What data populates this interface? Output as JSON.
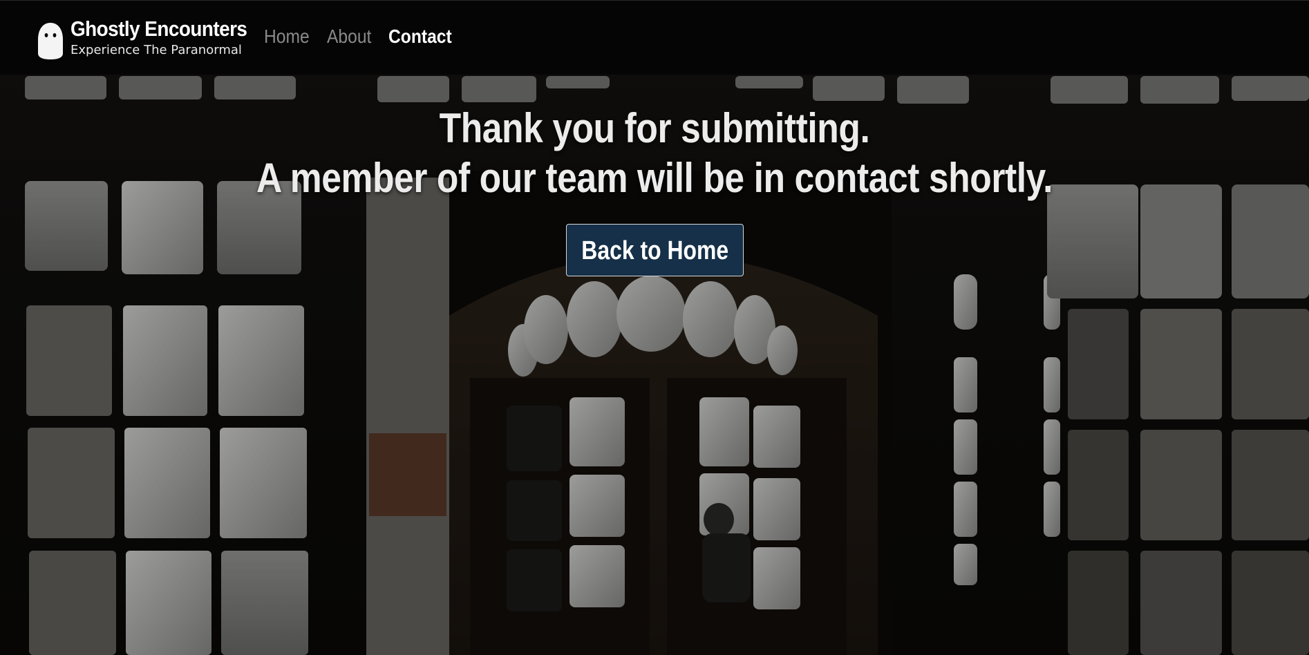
{
  "header": {
    "brand": {
      "title": "Ghostly Encounters",
      "tagline": "Experience The Paranormal",
      "icon": "ghost-icon"
    },
    "nav": [
      {
        "label": "Home",
        "active": false
      },
      {
        "label": "About",
        "active": false
      },
      {
        "label": "Contact",
        "active": true
      }
    ]
  },
  "hero": {
    "line1": "Thank you for submitting.",
    "line2": "A member of our team will be in contact shortly.",
    "button_label": "Back to Home"
  },
  "colors": {
    "navbar_bg": "#050505",
    "button_bg": "#153048",
    "text": "#ececec",
    "nav_inactive": "#8a8a8a"
  }
}
